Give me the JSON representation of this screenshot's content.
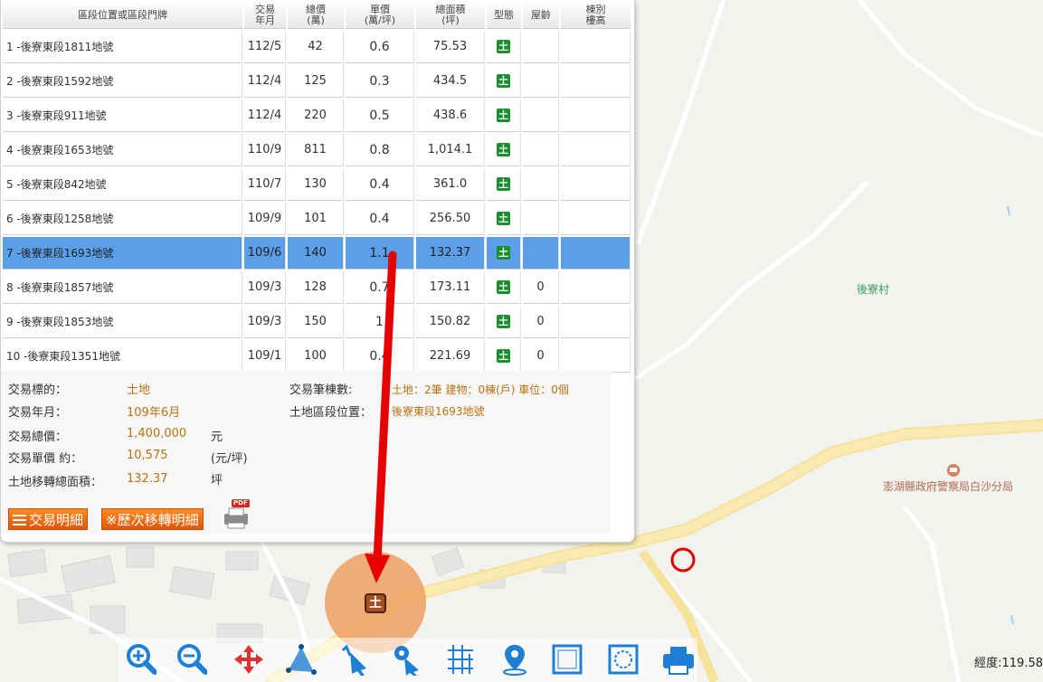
{
  "table": {
    "headers": [
      "區段位置或區段門牌",
      "交易\n年月",
      "總價\n(萬)",
      "單價\n(萬/坪)",
      "總面積\n(坪)",
      "型態",
      "屋齡",
      "棟別\n樓高"
    ],
    "rows": [
      {
        "loc": "1 -後寮東段1811地號",
        "date": "112/5",
        "total": "42",
        "unit": "0.6",
        "area": "75.53",
        "type": "土",
        "age": "",
        "floor": ""
      },
      {
        "loc": "2 -後寮東段1592地號",
        "date": "112/4",
        "total": "125",
        "unit": "0.3",
        "area": "434.5",
        "type": "土",
        "age": "",
        "floor": ""
      },
      {
        "loc": "3 -後寮東段911地號",
        "date": "112/4",
        "total": "220",
        "unit": "0.5",
        "area": "438.6",
        "type": "土",
        "age": "",
        "floor": ""
      },
      {
        "loc": "4 -後寮東段1653地號",
        "date": "110/9",
        "total": "811",
        "unit": "0.8",
        "area": "1,014.1",
        "type": "土",
        "age": "",
        "floor": ""
      },
      {
        "loc": "5 -後寮東段842地號",
        "date": "110/7",
        "total": "130",
        "unit": "0.4",
        "area": "361.0",
        "type": "土",
        "age": "",
        "floor": ""
      },
      {
        "loc": "6 -後寮東段1258地號",
        "date": "109/9",
        "total": "101",
        "unit": "0.4",
        "area": "256.50",
        "type": "土",
        "age": "",
        "floor": ""
      },
      {
        "loc": "7 -後寮東段1693地號",
        "date": "109/6",
        "total": "140",
        "unit": "1.1",
        "area": "132.37",
        "type": "土",
        "age": "",
        "floor": "",
        "selected": true
      },
      {
        "loc": "8 -後寮東段1857地號",
        "date": "109/3",
        "total": "128",
        "unit": "0.7",
        "area": "173.11",
        "type": "土",
        "age": "0",
        "floor": ""
      },
      {
        "loc": "9 -後寮東段1853地號",
        "date": "109/3",
        "total": "150",
        "unit": "1",
        "area": "150.82",
        "type": "土",
        "age": "0",
        "floor": ""
      },
      {
        "loc": "10 -後寮東段1351地號",
        "date": "109/1",
        "total": "100",
        "unit": "0.4",
        "area": "221.69",
        "type": "土",
        "age": "0",
        "floor": ""
      }
    ]
  },
  "detail": {
    "target_label": "交易標的：",
    "target_value": "土地",
    "date_label": "交易年月：",
    "date_value": "109年6月",
    "total_label": "交易總價：",
    "total_value": "1,400,000",
    "total_unit": "元",
    "unit_label": "交易單價 約：",
    "unit_value": "10,575",
    "unit_unit": "(元/坪)",
    "area_label": "土地移轉總面積：",
    "area_value": "132.37",
    "area_unit": "坪",
    "count_label": "交易筆棟數:",
    "count_value": "土地：2筆 建物：0棟(戶) 車位：0個",
    "position_label": "土地區段位置：",
    "position_value": "後寮東段1693地號"
  },
  "buttons": {
    "detail": "交易明細",
    "history": "※歷次移轉明細",
    "pdf_badge": "PDF"
  },
  "map": {
    "village_label": "後寮村",
    "police_label": "澎湖縣政府警察局白沙分局",
    "marker_label": "土"
  },
  "coord_text": "經度:119.58",
  "colors": {
    "selected_row": "#5b9fe8",
    "value_text": "#b8720e",
    "button": "#e8640d",
    "land_icon": "#1b8f2e",
    "arrow": "#e60000",
    "tool_icon": "#1f7fd6"
  },
  "toolbar": [
    {
      "name": "zoom-in-icon"
    },
    {
      "name": "zoom-out-icon"
    },
    {
      "name": "pan-icon"
    },
    {
      "name": "measure-area-icon"
    },
    {
      "name": "select-arrow-icon"
    },
    {
      "name": "point-query-icon"
    },
    {
      "name": "grid-icon"
    },
    {
      "name": "locate-pin-icon"
    },
    {
      "name": "frame-icon"
    },
    {
      "name": "dashed-frame-icon"
    },
    {
      "name": "print-icon"
    }
  ]
}
